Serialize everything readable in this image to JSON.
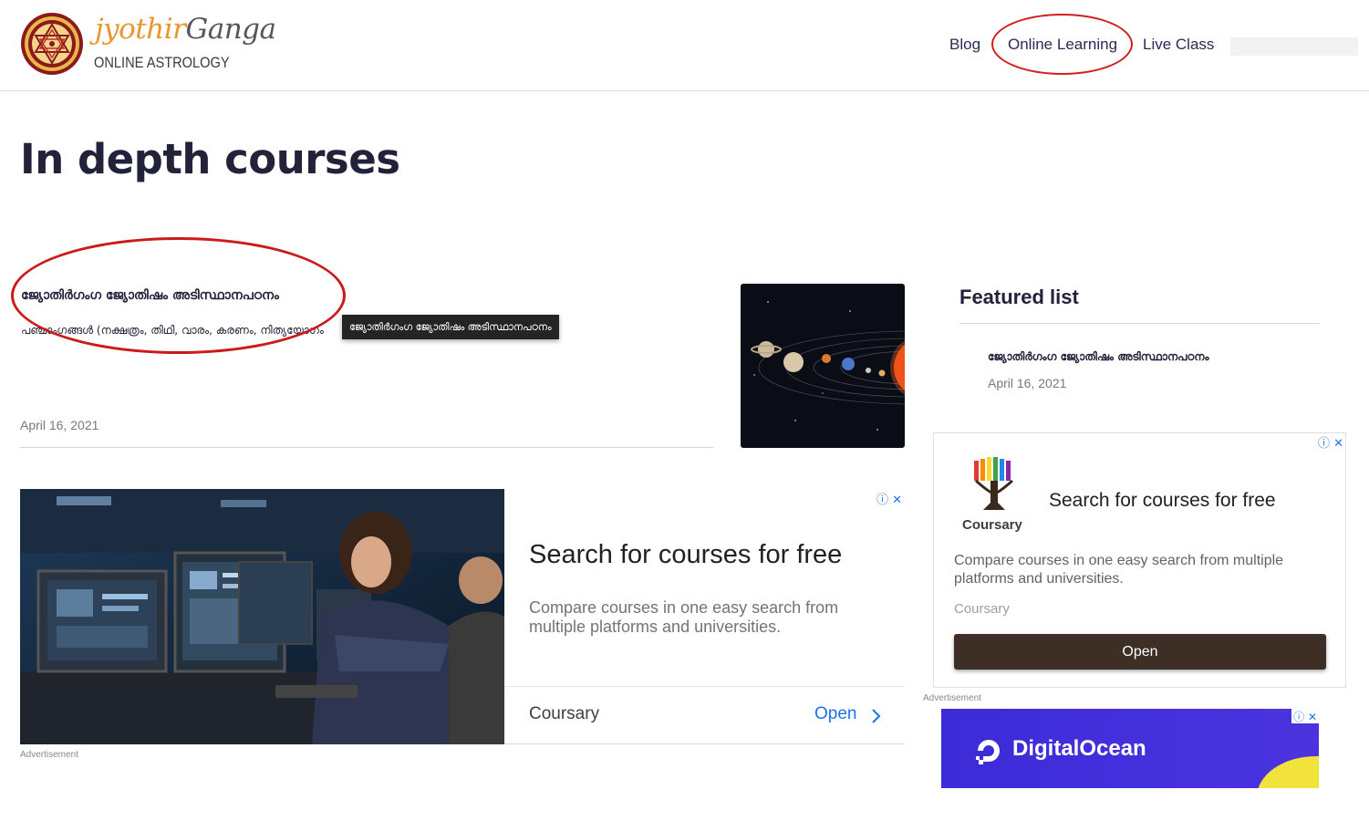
{
  "brand": {
    "name_part1": "jyothir",
    "name_part2": "Ganga",
    "tagline": "ONLINE ASTROLOGY",
    "primary_color": "#e8962e",
    "emblem_colors": [
      "#8b1a1a",
      "#e8b64a"
    ]
  },
  "nav": {
    "blog": "Blog",
    "online_learning": "Online Learning",
    "live_class": "Live Class"
  },
  "page": {
    "title": "In depth courses"
  },
  "post": {
    "title": "ജ്യോതിർഗംഗ ജ്യോതിഷം അടിസ്ഥാനപഠനം",
    "excerpt": "പഞ്ചാംഗങ്ങൾ (നക്ഷത്രം, തിഥി, വാരം, കരണം, നിത്യയോഗം",
    "tooltip": "ജ്യോതിർഗംഗ ജ്യോതിഷം അടിസ്ഥാനപഠനം",
    "date": "April 16, 2021",
    "thumbnail_icon": "solar-system-image"
  },
  "sidebar": {
    "featured_title": "Featured list",
    "items": [
      {
        "title": "ജ്യോതിർഗംഗ ജ്യോതിഷം അടിസ്ഥാനപഠനം",
        "date": "April 16, 2021"
      }
    ]
  },
  "ads": {
    "big": {
      "headline": "Search for courses for free",
      "body": "Compare courses in one easy search from multiple platforms and universities.",
      "advertiser": "Coursary",
      "cta": "Open",
      "label": "Advertisement",
      "image_icon": "office-computers-photo"
    },
    "side": {
      "logo_name": "Coursary",
      "headline": "Search for courses for free",
      "body": "Compare courses in one easy search from multiple platforms and universities.",
      "advertiser": "Coursary",
      "cta": "Open",
      "label": "Advertisement",
      "button_color": "#3e2f26"
    },
    "digitalocean": {
      "name": "DigitalOcean",
      "bg_color": "#3c2bd8"
    },
    "choices_glyphs": "ⓘ ✕"
  },
  "annotations": {
    "circle_color": "#d11f1f"
  }
}
